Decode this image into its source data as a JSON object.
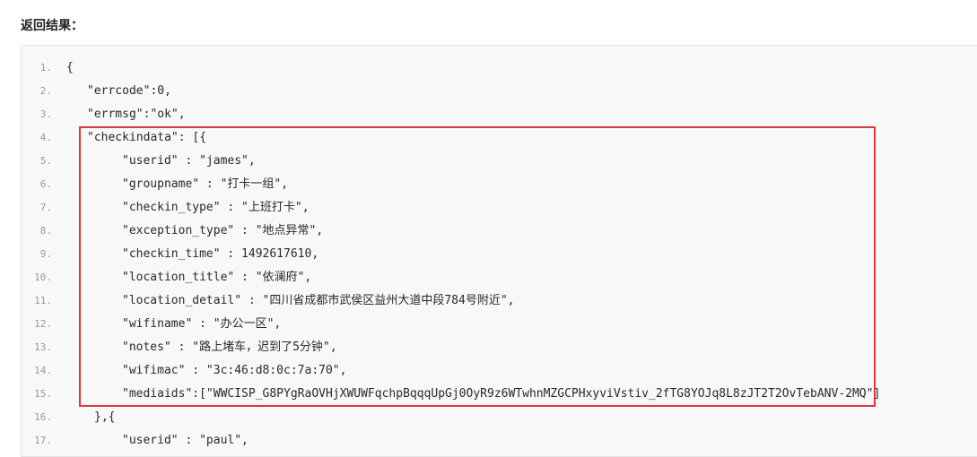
{
  "section_title": "返回结果：",
  "highlight_color": "#e0363b",
  "lines": [
    {
      "n": "1.",
      "text": "{"
    },
    {
      "n": "2.",
      "text": "\"errcode\":0,"
    },
    {
      "n": "3.",
      "text": "\"errmsg\":\"ok\","
    },
    {
      "n": "4.",
      "text": "\"checkindata\": [{"
    },
    {
      "n": "5.",
      "text": "\"userid\" : \"james\","
    },
    {
      "n": "6.",
      "text": "\"groupname\" : \"打卡一组\","
    },
    {
      "n": "7.",
      "text": "\"checkin_type\" : \"上班打卡\","
    },
    {
      "n": "8.",
      "text": "\"exception_type\" : \"地点异常\","
    },
    {
      "n": "9.",
      "text": "\"checkin_time\" : 1492617610,"
    },
    {
      "n": "10.",
      "text": "\"location_title\" : \"依澜府\","
    },
    {
      "n": "11.",
      "text": "\"location_detail\" : \"四川省成都市武侯区益州大道中段784号附近\","
    },
    {
      "n": "12.",
      "text": "\"wifiname\" : \"办公一区\","
    },
    {
      "n": "13.",
      "text": "\"notes\" : \"路上堵车，迟到了5分钟\","
    },
    {
      "n": "14.",
      "text": "\"wifimac\" : \"3c:46:d8:0c:7a:70\","
    },
    {
      "n": "15.",
      "text": "\"mediaids\":[\"WWCISP_G8PYgRaOVHjXWUWFqchpBqqqUpGj0OyR9z6WTwhnMZGCPHxyviVstiv_2fTG8YOJq8L8zJT2T2OvTebANV-2MQ\"]"
    },
    {
      "n": "16.",
      "text": "},{"
    },
    {
      "n": "17.",
      "text": "\"userid\" : \"paul\","
    }
  ]
}
